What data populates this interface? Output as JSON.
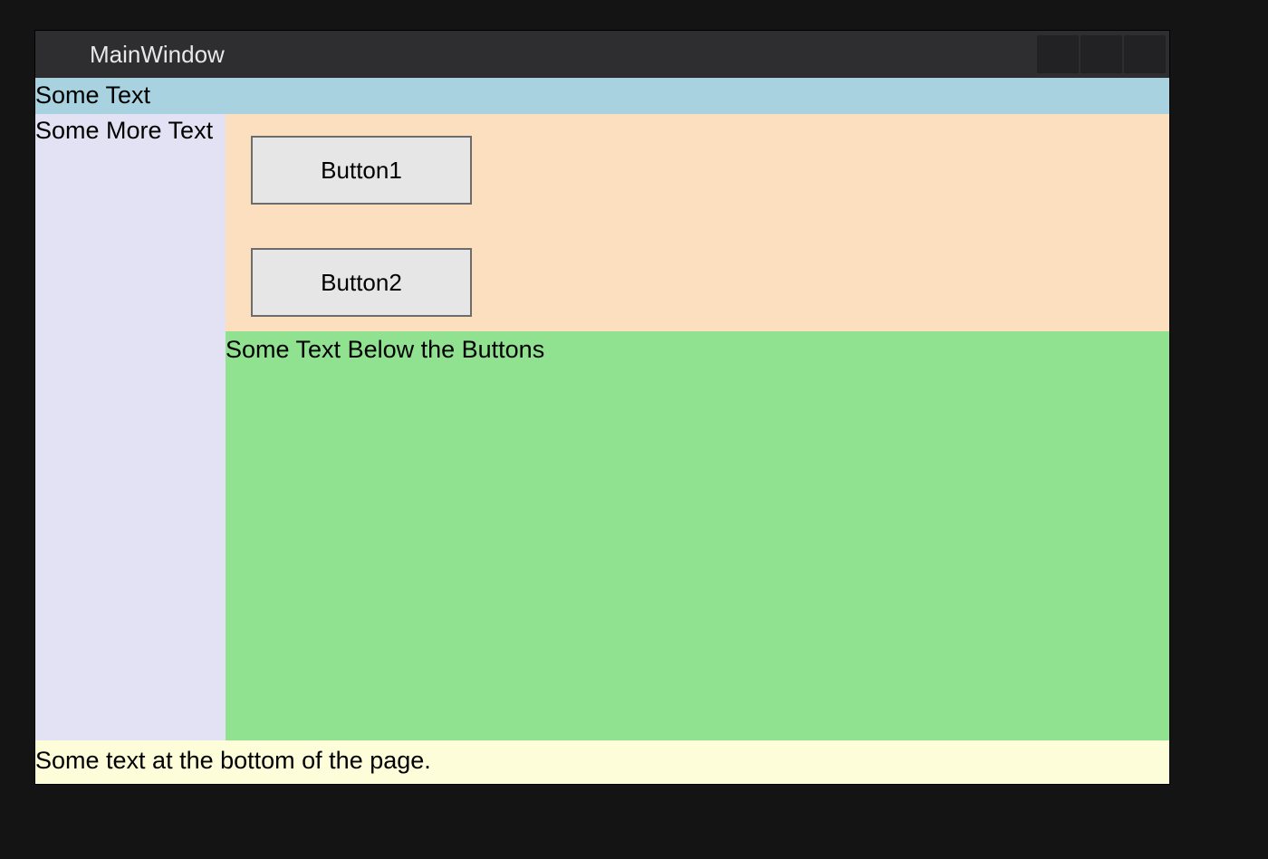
{
  "window": {
    "title": "MainWindow"
  },
  "top_banner": {
    "text": "Some Text"
  },
  "sidebar": {
    "text": "Some More Text"
  },
  "buttons": {
    "button1_label": "Button1",
    "button2_label": "Button2"
  },
  "green_panel": {
    "text": "Some Text Below the Buttons"
  },
  "footer": {
    "text": "Some text at the bottom of the page."
  },
  "colors": {
    "titlebar_bg": "#2e2e30",
    "top_banner_bg": "#a8d2df",
    "sidebar_bg": "#e2e2f4",
    "buttons_panel_bg": "#fcdfbf",
    "green_panel_bg": "#90e190",
    "footer_bg": "#fdfdd9",
    "button_bg": "#e6e6e6",
    "button_border": "#6c6c6c"
  }
}
